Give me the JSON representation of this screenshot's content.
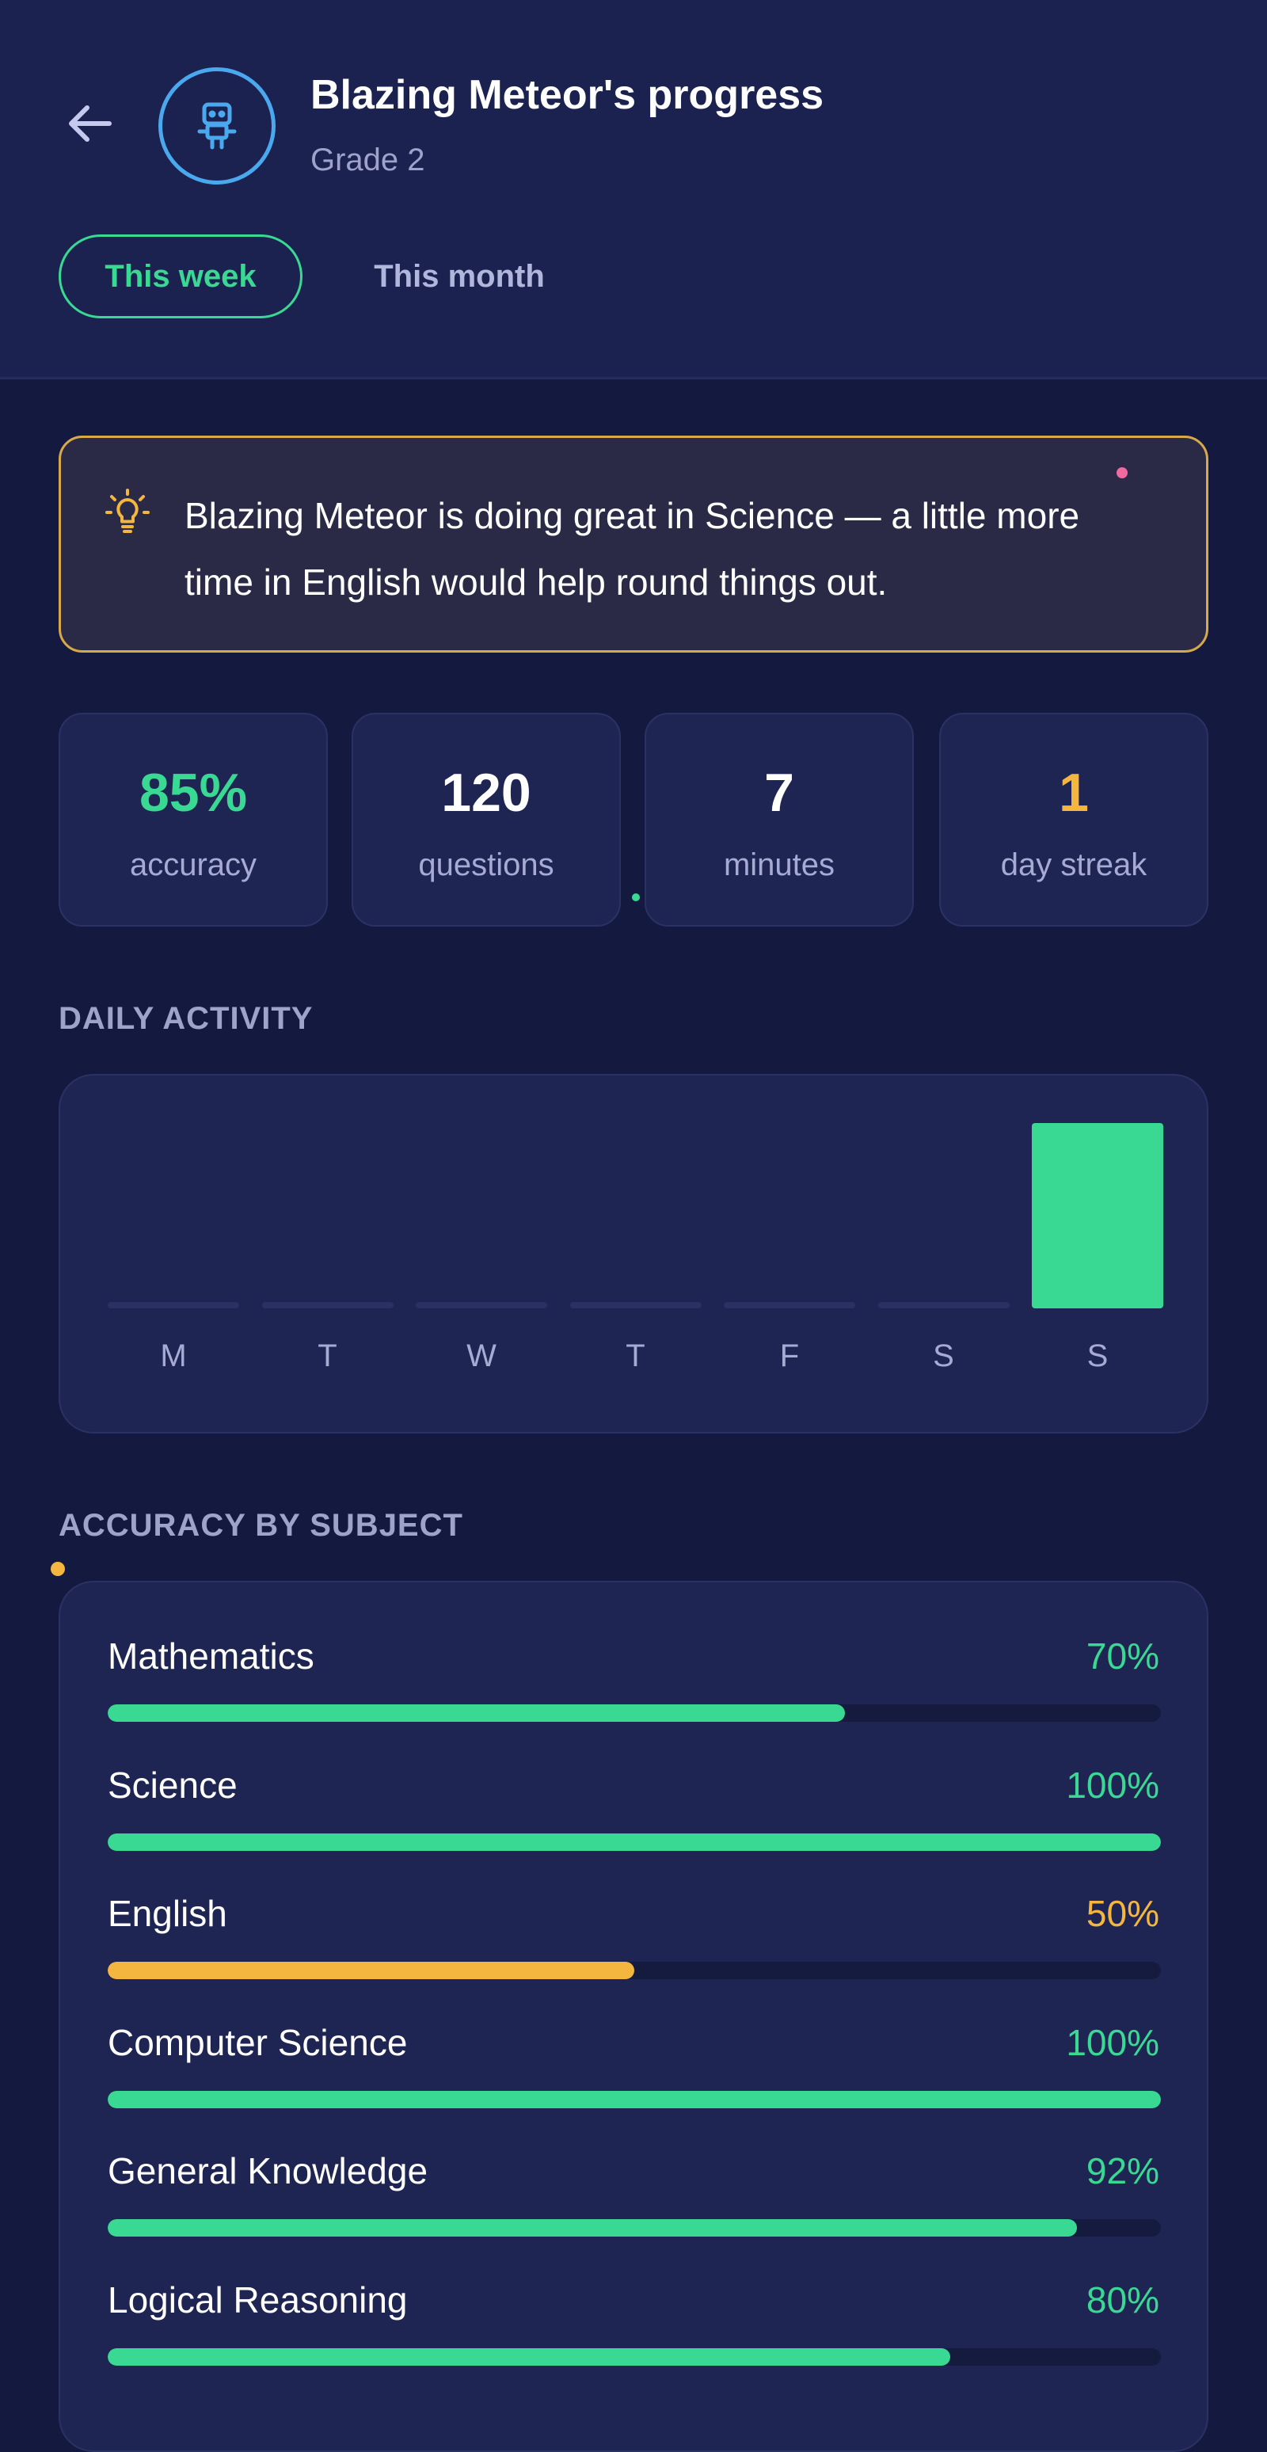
{
  "header": {
    "title": "Blazing Meteor's progress",
    "subtitle": "Grade 2",
    "avatar_icon": "robot-icon",
    "back_icon": "arrow-left-icon"
  },
  "tabs": [
    {
      "label": "This week",
      "active": true
    },
    {
      "label": "This month",
      "active": false
    }
  ],
  "insight": {
    "icon": "lightbulb-icon",
    "text": "Blazing Meteor is doing great in Science — a little more time in English would help round things out."
  },
  "stats": [
    {
      "value": "85%",
      "label": "accuracy",
      "color": "#3ad993"
    },
    {
      "value": "120",
      "label": "questions",
      "color": "#ffffff"
    },
    {
      "value": "7",
      "label": "minutes",
      "color": "#ffffff"
    },
    {
      "value": "1",
      "label": "day streak",
      "color": "#f4b63f"
    }
  ],
  "daily_activity": {
    "label": "DAILY ACTIVITY",
    "days": [
      "M",
      "T",
      "W",
      "T",
      "F",
      "S",
      "S"
    ],
    "minutes": [
      0,
      0,
      0,
      0,
      0,
      0,
      7
    ],
    "bar_color": "#3ad993",
    "empty_color": "#2a3163"
  },
  "accuracy_by_subject": {
    "label": "ACCURACY BY SUBJECT",
    "subjects": [
      {
        "name": "Mathematics",
        "pct": "70%",
        "value": 70,
        "color": "#3ad993"
      },
      {
        "name": "Science",
        "pct": "100%",
        "value": 100,
        "color": "#3ad993"
      },
      {
        "name": "English",
        "pct": "50%",
        "value": 50,
        "color": "#f4b63f"
      },
      {
        "name": "Computer Science",
        "pct": "100%",
        "value": 100,
        "color": "#3ad993"
      },
      {
        "name": "General Knowledge",
        "pct": "92%",
        "value": 92,
        "color": "#3ad993"
      },
      {
        "name": "Logical Reasoning",
        "pct": "80%",
        "value": 80,
        "color": "#3ad993"
      }
    ]
  },
  "colors": {
    "background": "#141a3f",
    "header": "#1c2250",
    "card": "#1f2553",
    "accent_green": "#3ad993",
    "accent_orange": "#f4b63f",
    "avatar_ring": "#4aa9ee",
    "insight_border": "#d8a94a"
  }
}
